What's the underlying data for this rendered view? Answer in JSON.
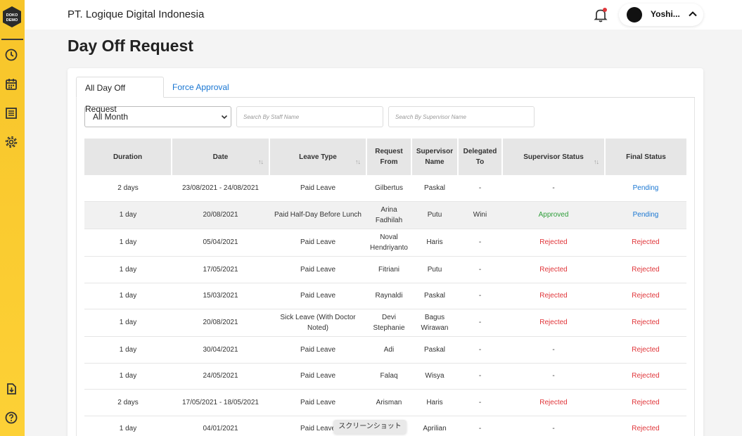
{
  "app": {
    "company": "PT. Logique Digital Indonesia",
    "logo_text": "DOKO DEMO",
    "user_name": "Yoshi...",
    "brand_color": "#f7c52a",
    "link_color": "#1976d2"
  },
  "sidebar": {
    "items": [
      {
        "icon": "clock-icon"
      },
      {
        "icon": "calendar-icon"
      },
      {
        "icon": "list-icon"
      },
      {
        "icon": "gear-icon"
      },
      {
        "icon": "download-report-icon"
      },
      {
        "icon": "help-icon"
      }
    ]
  },
  "page": {
    "title": "Day Off Request",
    "tabs": [
      "All Day Off Request",
      "Force Approval"
    ],
    "month_filter": "All Month",
    "search_staff_placeholder": "Search By Staff Name",
    "search_supervisor_placeholder": "Search By Supervisor Name"
  },
  "table": {
    "headers": {
      "duration": "Duration",
      "date": "Date",
      "leave_type": "Leave Type",
      "request_from": "Request From",
      "supervisor_name": "Supervisor Name",
      "delegated_to": "Delegated To",
      "supervisor_status": "Supervisor Status",
      "final_status": "Final Status"
    },
    "rows": [
      {
        "duration": "2 days",
        "date": "23/08/2021 - 24/08/2021",
        "leave_type": "Paid Leave",
        "request_from": "Gilbertus",
        "supervisor": "Paskal",
        "delegated": "-",
        "sup_status": "-",
        "final_status": "Pending"
      },
      {
        "duration": "1 day",
        "date": "20/08/2021",
        "leave_type": "Paid Half-Day Before Lunch",
        "request_from": "Arina Fadhilah",
        "supervisor": "Putu",
        "delegated": "Wini",
        "sup_status": "Approved",
        "final_status": "Pending"
      },
      {
        "duration": "1 day",
        "date": "05/04/2021",
        "leave_type": "Paid Leave",
        "request_from": "Noval Hendriyanto",
        "supervisor": "Haris",
        "delegated": "-",
        "sup_status": "Rejected",
        "final_status": "Rejected"
      },
      {
        "duration": "1 day",
        "date": "17/05/2021",
        "leave_type": "Paid Leave",
        "request_from": "Fitriani",
        "supervisor": "Putu",
        "delegated": "-",
        "sup_status": "Rejected",
        "final_status": "Rejected"
      },
      {
        "duration": "1 day",
        "date": "15/03/2021",
        "leave_type": "Paid Leave",
        "request_from": "Raynaldi",
        "supervisor": "Paskal",
        "delegated": "-",
        "sup_status": "Rejected",
        "final_status": "Rejected"
      },
      {
        "duration": "1 day",
        "date": "20/08/2021",
        "leave_type": "Sick Leave (With Doctor Noted)",
        "request_from": "Devi Stephanie",
        "supervisor": "Bagus Wirawan",
        "delegated": "-",
        "sup_status": "Rejected",
        "final_status": "Rejected"
      },
      {
        "duration": "1 day",
        "date": "30/04/2021",
        "leave_type": "Paid Leave",
        "request_from": "Adi",
        "supervisor": "Paskal",
        "delegated": "-",
        "sup_status": "-",
        "final_status": "Rejected"
      },
      {
        "duration": "1 day",
        "date": "24/05/2021",
        "leave_type": "Paid Leave",
        "request_from": "Falaq",
        "supervisor": "Wisya",
        "delegated": "-",
        "sup_status": "-",
        "final_status": "Rejected"
      },
      {
        "duration": "2 days",
        "date": "17/05/2021 - 18/05/2021",
        "leave_type": "Paid Leave",
        "request_from": "Arisman",
        "supervisor": "Haris",
        "delegated": "-",
        "sup_status": "Rejected",
        "final_status": "Rejected"
      },
      {
        "duration": "1 day",
        "date": "04/01/2021",
        "leave_type": "Paid Leave",
        "request_from": "",
        "supervisor": "Aprilian",
        "delegated": "-",
        "sup_status": "-",
        "final_status": "Rejected"
      }
    ]
  },
  "overlay": {
    "screenshot_toast": "スクリーンショット"
  }
}
